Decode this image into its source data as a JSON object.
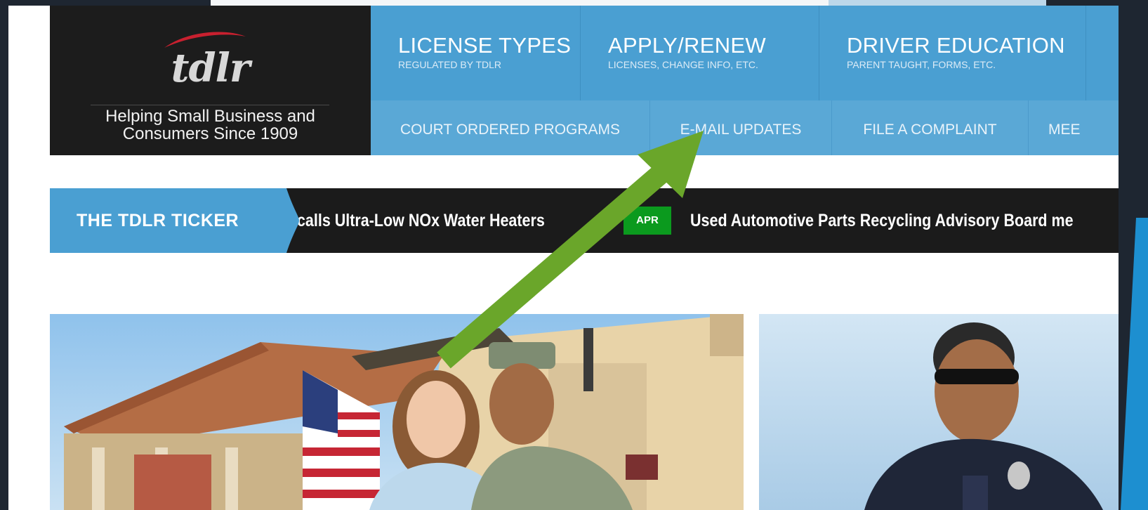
{
  "logo": {
    "wordmark": "tdlr",
    "tagline": "Helping Small Business and Consumers Since 1909"
  },
  "nav_primary": [
    {
      "title": "LICENSE TYPES",
      "subtitle": "REGULATED BY TDLR"
    },
    {
      "title": "APPLY/RENEW",
      "subtitle": "LICENSES, CHANGE INFO, ETC."
    },
    {
      "title": "DRIVER EDUCATION",
      "subtitle": "PARENT TAUGHT, FORMS, ETC."
    }
  ],
  "nav_secondary": [
    {
      "label": "COURT ORDERED PROGRAMS"
    },
    {
      "label": "E-MAIL UPDATES"
    },
    {
      "label": "FILE A COMPLAINT"
    },
    {
      "label": "MEE"
    }
  ],
  "ticker": {
    "label": "THE TDLR TICKER",
    "message_1": "ecalls Ultra-Low NOx Water Heaters",
    "badge": "APR",
    "message_2": "Used Automotive Parts Recycling Advisory Board me"
  },
  "colors": {
    "nav_blue": "#4a9fd2",
    "nav_blue_light": "#5aa8d6",
    "logo_dark": "#1c1c1c",
    "ticker_dark": "#1b1b1b",
    "badge_green": "#0b9a1e",
    "annotation_arrow": "#6aa62a",
    "slide_accent": "#1d8fd0"
  },
  "annotation": {
    "type": "arrow",
    "points_to": "E-MAIL UPDATES"
  }
}
